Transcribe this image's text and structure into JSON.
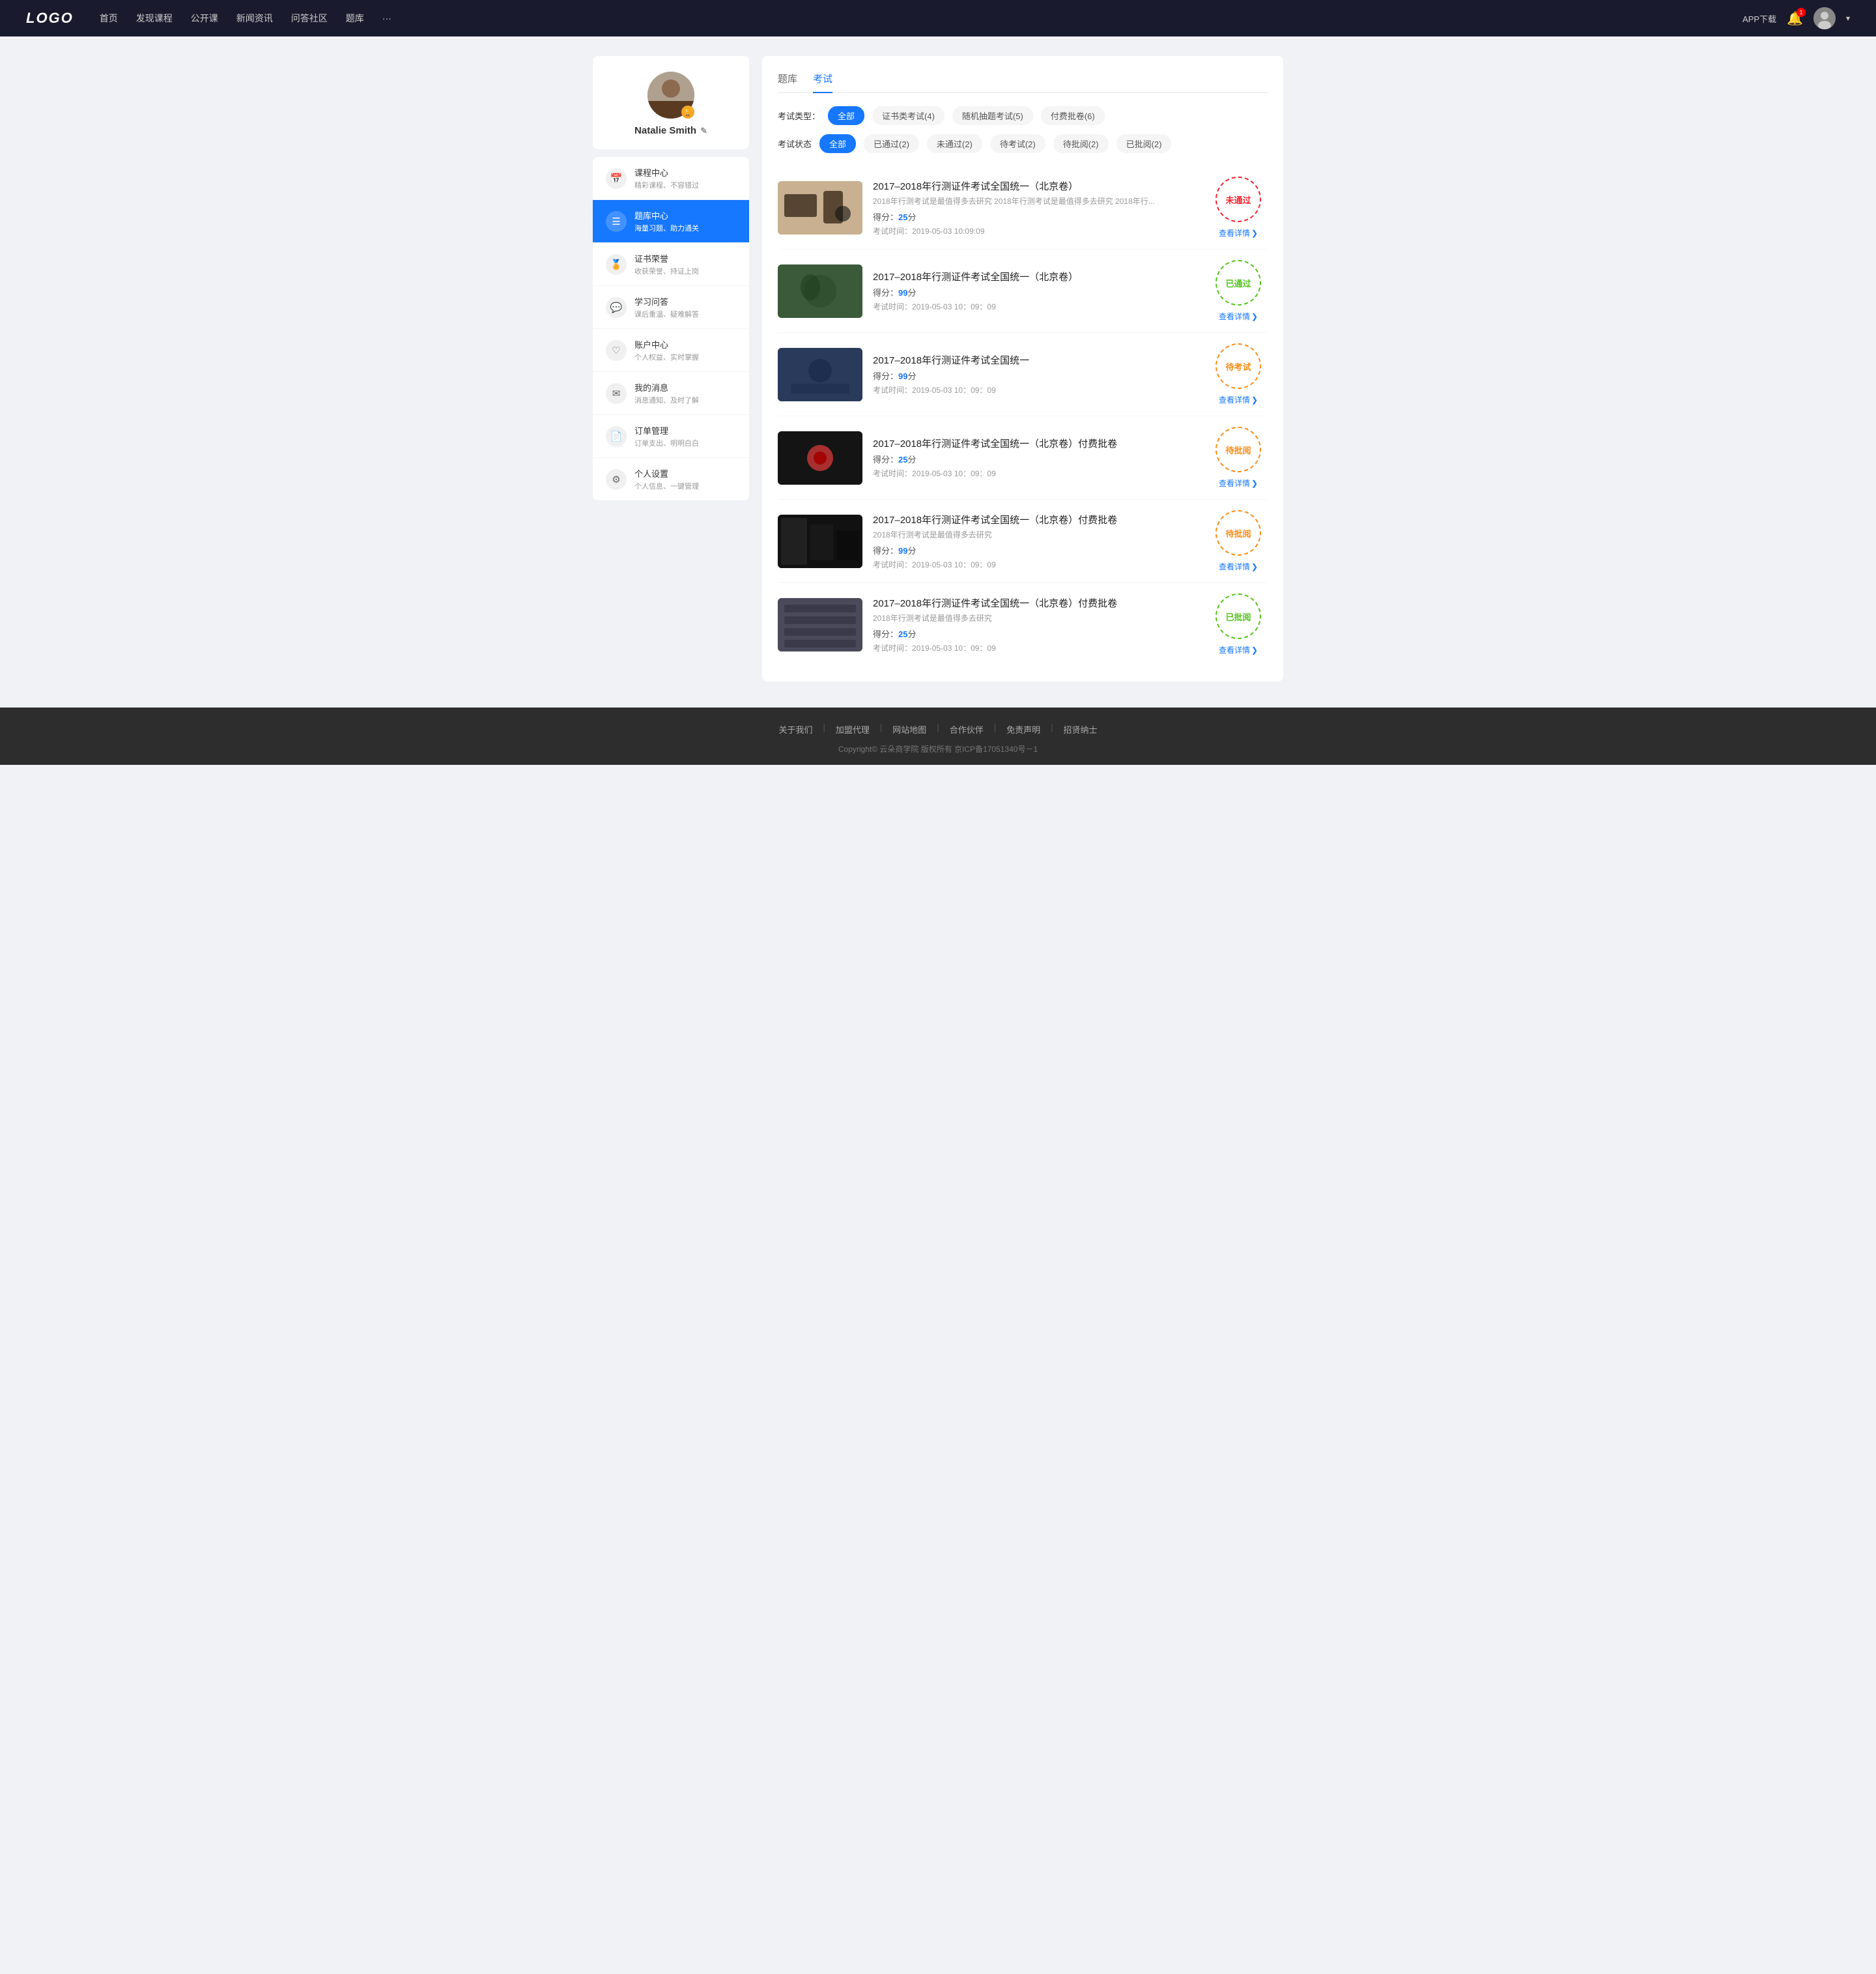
{
  "navbar": {
    "logo": "LOGO",
    "nav_items": [
      "首页",
      "发现课程",
      "公开课",
      "新闻资讯",
      "问答社区",
      "题库",
      "···"
    ],
    "app_btn": "APP下载",
    "more_icon": "···"
  },
  "sidebar": {
    "user": {
      "name": "Natalie Smith",
      "edit_icon": "✎"
    },
    "menu": [
      {
        "id": "course",
        "icon": "📅",
        "title": "课程中心",
        "subtitle": "精彩课程、不容错过"
      },
      {
        "id": "question",
        "icon": "☰",
        "title": "题库中心",
        "subtitle": "海量习题、助力通关",
        "active": true
      },
      {
        "id": "certificate",
        "icon": "⚙",
        "title": "证书荣誉",
        "subtitle": "收获荣誉、持证上岗"
      },
      {
        "id": "qa",
        "icon": "💬",
        "title": "学习问答",
        "subtitle": "课后重温、疑难解答"
      },
      {
        "id": "account",
        "icon": "♡",
        "title": "账户中心",
        "subtitle": "个人权益、实时掌握"
      },
      {
        "id": "message",
        "icon": "✉",
        "title": "我的消息",
        "subtitle": "消息通知、及时了解"
      },
      {
        "id": "order",
        "icon": "📄",
        "title": "订单管理",
        "subtitle": "订单支出、明明白白"
      },
      {
        "id": "settings",
        "icon": "⚙",
        "title": "个人设置",
        "subtitle": "个人信息、一键管理"
      }
    ]
  },
  "content": {
    "top_tabs": [
      {
        "label": "题库",
        "active": false
      },
      {
        "label": "考试",
        "active": true
      }
    ],
    "type_filters": {
      "label": "考试类型：",
      "items": [
        {
          "label": "全部",
          "active": true
        },
        {
          "label": "证书类考试(4)",
          "active": false
        },
        {
          "label": "随机抽题考试(5)",
          "active": false
        },
        {
          "label": "付费批卷(6)",
          "active": false
        }
      ]
    },
    "status_filters": {
      "label": "考试状态",
      "items": [
        {
          "label": "全部",
          "active": true
        },
        {
          "label": "已通过(2)",
          "active": false
        },
        {
          "label": "未通过(2)",
          "active": false
        },
        {
          "label": "待考试(2)",
          "active": false
        },
        {
          "label": "待批阅(2)",
          "active": false
        },
        {
          "label": "已批阅(2)",
          "active": false
        }
      ]
    },
    "exams": [
      {
        "id": 1,
        "title": "2017–2018年行测证件考试全国统一（北京卷）",
        "desc": "2018年行测考试是最值得多去研究 2018年行测考试是最值得多去研究 2018年行...",
        "score_label": "得分：",
        "score": "25",
        "score_unit": "分",
        "time_label": "考试时间：",
        "time": "2019-05-03  10:09:09",
        "status": "未通过",
        "status_type": "fail",
        "link_label": "查看详情"
      },
      {
        "id": 2,
        "title": "2017–2018年行测证件考试全国统一（北京卷）",
        "desc": "",
        "score_label": "得分：",
        "score": "99",
        "score_unit": "分",
        "time_label": "考试时间：",
        "time": "2019-05-03  10：09：09",
        "status": "已通过",
        "status_type": "pass",
        "link_label": "查看详情"
      },
      {
        "id": 3,
        "title": "2017–2018年行测证件考试全国统一",
        "desc": "",
        "score_label": "得分：",
        "score": "99",
        "score_unit": "分",
        "time_label": "考试时间：",
        "time": "2019-05-03  10：09：09",
        "status": "待考试",
        "status_type": "pending",
        "link_label": "查看详情"
      },
      {
        "id": 4,
        "title": "2017–2018年行测证件考试全国统一（北京卷）付费批卷",
        "desc": "",
        "score_label": "得分：",
        "score": "25",
        "score_unit": "分",
        "time_label": "考试时间：",
        "time": "2019-05-03  10：09：09",
        "status": "待批阅",
        "status_type": "pending",
        "link_label": "查看详情"
      },
      {
        "id": 5,
        "title": "2017–2018年行测证件考试全国统一（北京卷）付费批卷",
        "desc": "2018年行测考试是最值得多去研究",
        "score_label": "得分：",
        "score": "99",
        "score_unit": "分",
        "time_label": "考试时间：",
        "time": "2019-05-03  10：09：09",
        "status": "待批阅",
        "status_type": "pending",
        "link_label": "查看详情"
      },
      {
        "id": 6,
        "title": "2017–2018年行测证件考试全国统一（北京卷）付费批卷",
        "desc": "2018年行测考试是最值得多去研究",
        "score_label": "得分：",
        "score": "25",
        "score_unit": "分",
        "time_label": "考试时间：",
        "time": "2019-05-03  10：09：09",
        "status": "已批阅",
        "status_type": "reviewed",
        "link_label": "查看详情"
      }
    ]
  },
  "footer": {
    "links": [
      "关于我们",
      "加盟代理",
      "网站地图",
      "合作伙伴",
      "免责声明",
      "招贤纳士"
    ],
    "copyright": "Copyright©  云朵商学院  版权所有    京ICP备17051340号－1"
  }
}
